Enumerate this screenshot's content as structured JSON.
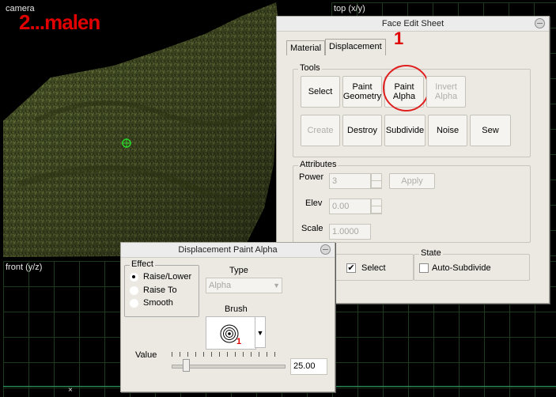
{
  "viewports": {
    "camera": {
      "label": "camera",
      "annotation": "2...malen"
    },
    "top": {
      "label": "top (x/y)"
    },
    "front": {
      "label": "front (y/z)"
    }
  },
  "face_edit": {
    "title": "Face Edit Sheet",
    "tabs": [
      "Material",
      "Displacement"
    ],
    "annotation": "1",
    "tools_label": "Tools",
    "tools_row1": [
      "Select",
      "Paint\nGeometry",
      "Paint\nAlpha",
      "Invert\nAlpha"
    ],
    "tools_row2": [
      "Create",
      "Destroy",
      "Subdivide",
      "Noise",
      "Sew"
    ],
    "attributes_label": "Attributes",
    "power_label": "Power",
    "power_value": "3",
    "apply_label": "Apply",
    "elev_label": "Elev",
    "elev_value": "0.00",
    "scale_label": "Scale",
    "scale_value": "1.0000",
    "select_label": "Select",
    "state_label": "State",
    "auto_subdivide_label": "Auto-Subdivide"
  },
  "paint_alpha": {
    "title": "Displacement Paint Alpha",
    "effect_label": "Effect",
    "effects": [
      "Raise/Lower",
      "Raise To",
      "Smooth"
    ],
    "effect_selected": "Raise/Lower",
    "type_label": "Type",
    "type_value": "Alpha",
    "brush_label": "Brush",
    "brush_annotation": "1",
    "value_label": "Value",
    "value": "25.00",
    "slider_fraction": 0.1
  },
  "colors": {
    "annotation_red": "#e00000",
    "window_bg": "#ece9e3",
    "grid": "#1d3a1d"
  }
}
